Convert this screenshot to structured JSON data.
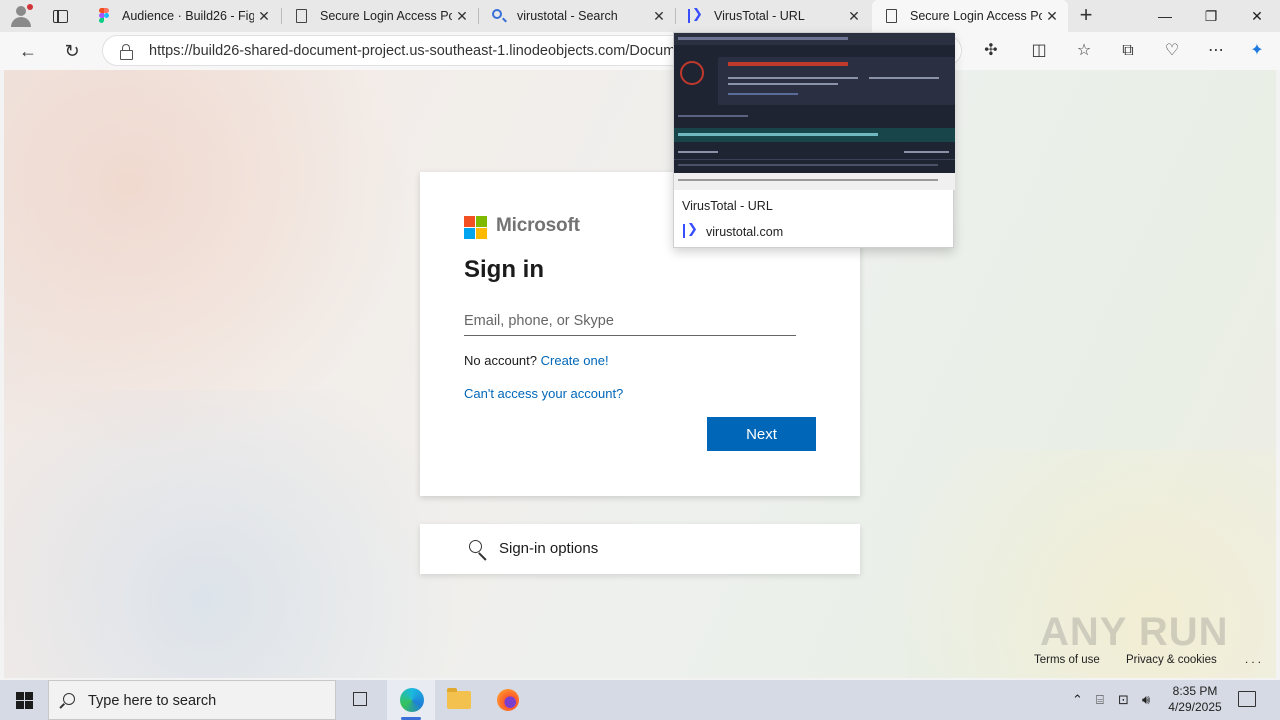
{
  "browser": {
    "tabs": [
      {
        "label": "Audience · Build26 - Figma",
        "icon": "figma-icon"
      },
      {
        "label": "Secure Login Access Portal",
        "icon": "document-icon"
      },
      {
        "label": "virustotal - Search",
        "icon": "search-icon"
      },
      {
        "label": "VirusTotal - URL",
        "icon": "virustotal-icon"
      },
      {
        "label": "Secure Login Access Portal",
        "icon": "document-icon",
        "active": true
      }
    ],
    "url": "https://build26-shared-document-project.us-southeast-1.linodeobjects.com/Documents",
    "preview": {
      "title": "VirusTotal - URL",
      "domain": "virustotal.com"
    }
  },
  "signin": {
    "brand": "Microsoft",
    "title": "Sign in",
    "email_placeholder": "Email, phone, or Skype",
    "no_account": "No account?",
    "create_link": "Create one!",
    "cant_access": "Can't access your account?",
    "next_label": "Next",
    "options_label": "Sign-in options"
  },
  "footer": {
    "terms": "Terms of use",
    "privacy": "Privacy & cookies",
    "more": ". . ."
  },
  "watermark": "ANY RUN",
  "taskbar": {
    "search_placeholder": "Type here to search",
    "time": "8:35 PM",
    "date": "4/29/2025"
  },
  "colors": {
    "accent": "#0067b8",
    "ms_red": "#f25022",
    "ms_green": "#7fba00",
    "ms_blue": "#00a4ef",
    "ms_yellow": "#ffb900"
  }
}
